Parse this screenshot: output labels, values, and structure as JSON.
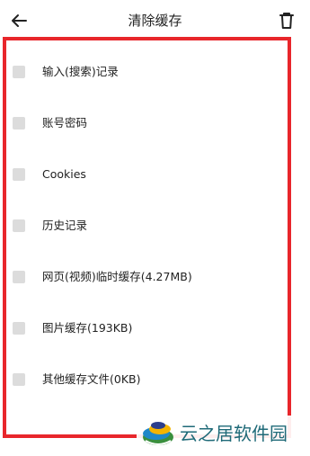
{
  "header": {
    "title": "清除缓存",
    "back_icon": "arrow-left-icon",
    "delete_icon": "trash-icon"
  },
  "items": [
    {
      "label": "输入(搜索)记录",
      "checked": false
    },
    {
      "label": "账号密码",
      "checked": false
    },
    {
      "label": "Cookies",
      "checked": false
    },
    {
      "label": "历史记录",
      "checked": false
    },
    {
      "label": "网页(视频)临时缓存(4.27MB)",
      "checked": false
    },
    {
      "label": "图片缓存(193KB)",
      "checked": false
    },
    {
      "label": "其他缓存文件(0KB)",
      "checked": false
    }
  ],
  "watermark": {
    "text": "云之居软件园"
  },
  "colors": {
    "highlight_border": "#e8262b",
    "checkbox": "#dcdcdc",
    "watermark_text": "#1f6a78"
  }
}
